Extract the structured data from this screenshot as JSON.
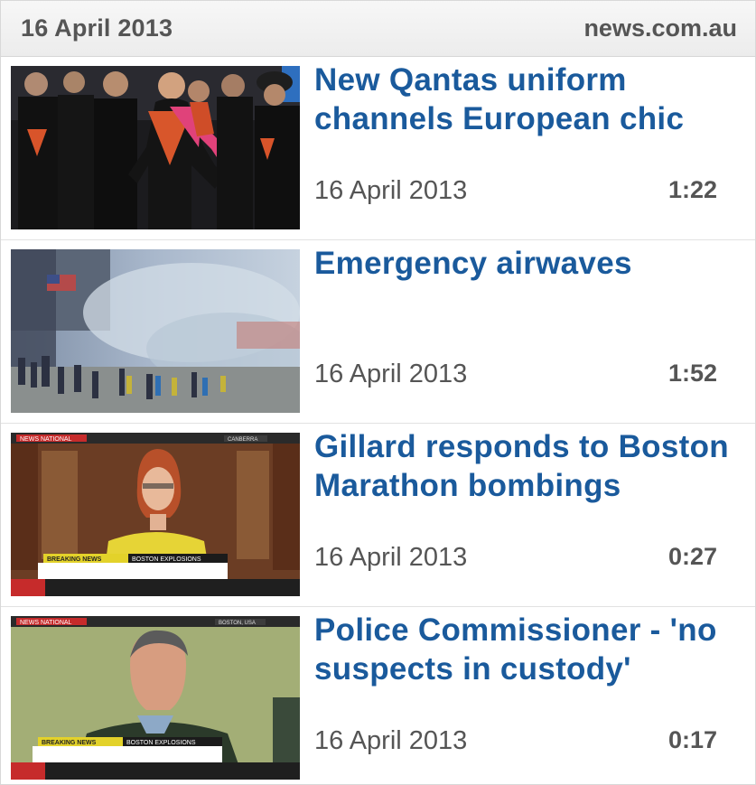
{
  "header": {
    "date": "16 April 2013",
    "source": "news.com.au"
  },
  "videos": [
    {
      "title": "New Qantas uniform channels European chic",
      "date": "16 April 2013",
      "duration": "1:22"
    },
    {
      "title": "Emergency airwaves",
      "date": "16 April 2013",
      "duration": "1:52"
    },
    {
      "title": "Gillard responds to Boston Marathon bombings",
      "date": "16 April 2013",
      "duration": "0:27",
      "thumb_text": {
        "channel": "NEWS NATIONAL",
        "location": "CANBERRA",
        "banner_left": "BREAKING NEWS",
        "banner_right": "BOSTON EXPLOSIONS"
      }
    },
    {
      "title": "Police Commissioner - 'no suspects in custody'",
      "date": "16 April 2013",
      "duration": "0:17",
      "thumb_text": {
        "channel": "NEWS NATIONAL",
        "location": "BOSTON, USA",
        "banner_left": "BREAKING NEWS",
        "banner_right": "BOSTON EXPLOSIONS"
      }
    }
  ],
  "colors": {
    "title": "#1a5a9c",
    "meta": "#555555",
    "header_bg": "#eeeeee"
  }
}
